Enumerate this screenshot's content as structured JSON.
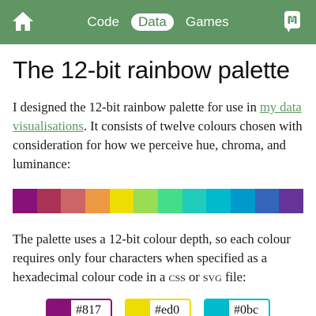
{
  "header": {
    "nav": [
      {
        "label": "Code",
        "active": false
      },
      {
        "label": "Data",
        "active": true
      },
      {
        "label": "Games",
        "active": false
      }
    ],
    "home_icon": "home-icon",
    "social_icon": "mastodon-icon",
    "bar_color": "#609564"
  },
  "article": {
    "title": "The 12-bit rainbow palette",
    "intro_before_link": "I designed the 12-bit rainbow palette for use in ",
    "intro_link": "my data visualisations",
    "intro_after_link": ". It consists of twelve colours chosen with consideration for how we perceive hue, chroma, and luminance:",
    "palette": [
      "#881177",
      "#aa3355",
      "#cc6666",
      "#ee9944",
      "#eedd00",
      "#99dd55",
      "#44dd88",
      "#22ccbb",
      "#00bbcc",
      "#0099cc",
      "#3366bb",
      "#663399"
    ],
    "para2_before_css": "The palette uses a 12-bit colour depth, so each colour requires only four characters when specified as a hexadecimal colour code in a ",
    "css_label": "css",
    "para2_or": " or ",
    "svg_label": "svg",
    "para2_end": " file:",
    "chips": [
      {
        "code": "#817",
        "color": "#881177"
      },
      {
        "code": "#ed0",
        "color": "#eedd00"
      },
      {
        "code": "#0bc",
        "color": "#00bbcc"
      }
    ]
  }
}
